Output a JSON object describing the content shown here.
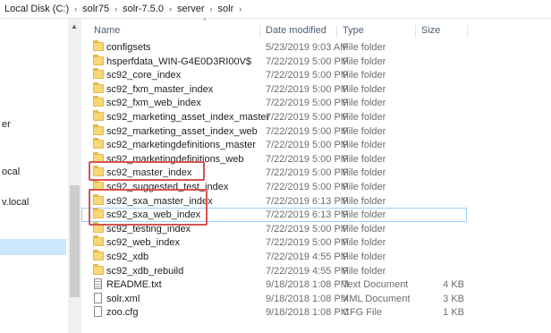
{
  "breadcrumb": [
    "Local Disk (C:)",
    "solr75",
    "solr-7.5.0",
    "server",
    "solr"
  ],
  "breadcrumb_separator": "›",
  "nav_pane": {
    "items": [
      {
        "label": "er"
      },
      {
        "label": "ocal"
      },
      {
        "label": "v.local"
      }
    ]
  },
  "columns": {
    "name": "Name",
    "date": "Date modified",
    "type": "Type",
    "size": "Size"
  },
  "files": [
    {
      "name": "configsets",
      "date": "5/23/2019 9:03 AM",
      "type": "File folder",
      "size": "",
      "icon": "folder-icon"
    },
    {
      "name": "hsperfdata_WIN-G4E0D3RI00V$",
      "date": "7/22/2019 5:00 PM",
      "type": "File folder",
      "size": "",
      "icon": "folder-icon"
    },
    {
      "name": "sc92_core_index",
      "date": "7/22/2019 5:00 PM",
      "type": "File folder",
      "size": "",
      "icon": "folder-icon"
    },
    {
      "name": "sc92_fxm_master_index",
      "date": "7/22/2019 5:00 PM",
      "type": "File folder",
      "size": "",
      "icon": "folder-icon"
    },
    {
      "name": "sc92_fxm_web_index",
      "date": "7/22/2019 5:00 PM",
      "type": "File folder",
      "size": "",
      "icon": "folder-icon"
    },
    {
      "name": "sc92_marketing_asset_index_master",
      "date": "7/22/2019 5:00 PM",
      "type": "File folder",
      "size": "",
      "icon": "folder-icon"
    },
    {
      "name": "sc92_marketing_asset_index_web",
      "date": "7/22/2019 5:00 PM",
      "type": "File folder",
      "size": "",
      "icon": "folder-icon"
    },
    {
      "name": "sc92_marketingdefinitions_master",
      "date": "7/22/2019 5:00 PM",
      "type": "File folder",
      "size": "",
      "icon": "folder-icon"
    },
    {
      "name": "sc92_marketingdefinitions_web",
      "date": "7/22/2019 5:00 PM",
      "type": "File folder",
      "size": "",
      "icon": "folder-icon"
    },
    {
      "name": "sc92_master_index",
      "date": "7/22/2019 5:00 PM",
      "type": "File folder",
      "size": "",
      "icon": "folder-icon"
    },
    {
      "name": "sc92_suggested_test_index",
      "date": "7/22/2019 5:00 PM",
      "type": "File folder",
      "size": "",
      "icon": "folder-icon"
    },
    {
      "name": "sc92_sxa_master_index",
      "date": "7/22/2019 6:13 PM",
      "type": "File folder",
      "size": "",
      "icon": "folder-icon"
    },
    {
      "name": "sc92_sxa_web_index",
      "date": "7/22/2019 6:13 PM",
      "type": "File folder",
      "size": "",
      "icon": "folder-icon"
    },
    {
      "name": "sc92_testing_index",
      "date": "7/22/2019 5:00 PM",
      "type": "File folder",
      "size": "",
      "icon": "folder-icon"
    },
    {
      "name": "sc92_web_index",
      "date": "7/22/2019 5:00 PM",
      "type": "File folder",
      "size": "",
      "icon": "folder-icon"
    },
    {
      "name": "sc92_xdb",
      "date": "7/22/2019 4:55 PM",
      "type": "File folder",
      "size": "",
      "icon": "folder-icon"
    },
    {
      "name": "sc92_xdb_rebuild",
      "date": "7/22/2019 4:55 PM",
      "type": "File folder",
      "size": "",
      "icon": "folder-icon"
    },
    {
      "name": "README.txt",
      "date": "9/18/2018 1:08 PM",
      "type": "Text Document",
      "size": "4 KB",
      "icon": "text-file-icon"
    },
    {
      "name": "solr.xml",
      "date": "9/18/2018 1:08 PM",
      "type": "XML Document",
      "size": "3 KB",
      "icon": "xml-file-icon"
    },
    {
      "name": "zoo.cfg",
      "date": "9/18/2018 1:08 PM",
      "type": "CFG File",
      "size": "1 KB",
      "icon": "file-icon"
    }
  ],
  "colors": {
    "highlight_box": "#d9534f",
    "folder": "#f8d775",
    "selection_outline": "#99d1ff"
  }
}
